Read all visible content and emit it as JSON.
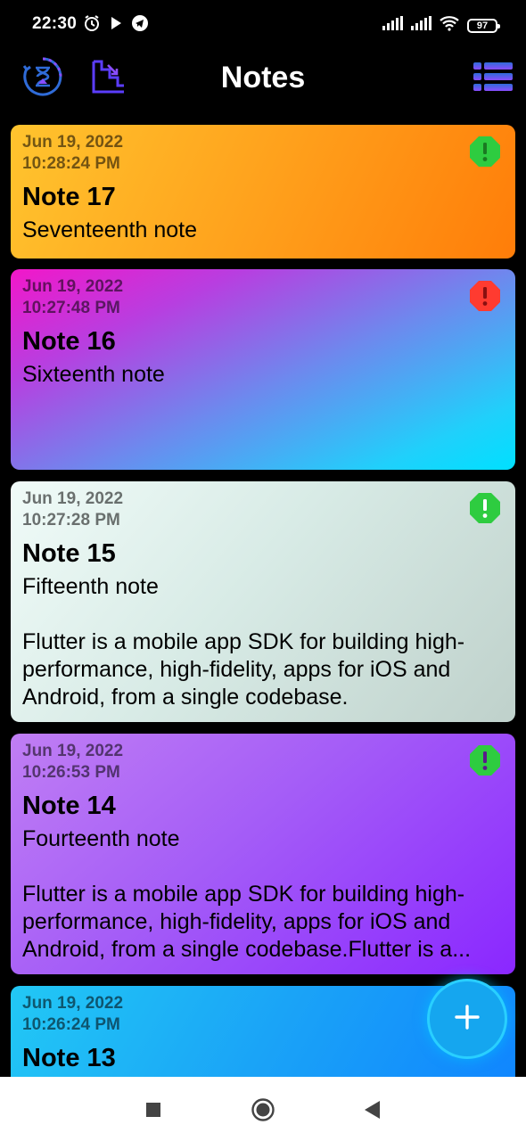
{
  "status_bar": {
    "time": "22:30",
    "battery": "97"
  },
  "app_bar": {
    "title": "Notes",
    "left_icons": [
      "history-timer-icon",
      "stairs-chart-icon"
    ],
    "right_icon": "list-view-icon"
  },
  "notes": [
    {
      "date": "Jun 19, 2022",
      "time": "10:28:24 PM",
      "title": "Note 17",
      "body": "Seventeenth note",
      "priority": "normal",
      "priority_color": "#2ecc40"
    },
    {
      "date": "Jun 19, 2022",
      "time": "10:27:48 PM",
      "title": "Note 16",
      "body": "Sixteenth note",
      "priority": "high",
      "priority_color": "#ff3b30"
    },
    {
      "date": "Jun 19, 2022",
      "time": "10:27:28 PM",
      "title": "Note 15",
      "body": "Fifteenth note\n\nFlutter is a mobile app SDK for building high-performance, high-fidelity, apps for iOS and Android, from a single codebase.",
      "priority": "normal",
      "priority_color": "#2ecc40"
    },
    {
      "date": "Jun 19, 2022",
      "time": "10:26:53 PM",
      "title": "Note 14",
      "body": "Fourteenth note\n\nFlutter is a mobile app SDK for building high-performance, high-fidelity, apps for iOS and Android, from a single codebase.Flutter is a...",
      "priority": "normal",
      "priority_color": "#2ecc40"
    },
    {
      "date": "Jun 19, 2022",
      "time": "10:26:24 PM",
      "title": "Note 13",
      "body": "",
      "priority": "normal",
      "priority_color": "#2ecc40"
    }
  ],
  "fab": {
    "icon": "plus-icon"
  },
  "nav_bar": {
    "icons": [
      "recents-square-icon",
      "home-circle-icon",
      "back-triangle-icon"
    ]
  }
}
